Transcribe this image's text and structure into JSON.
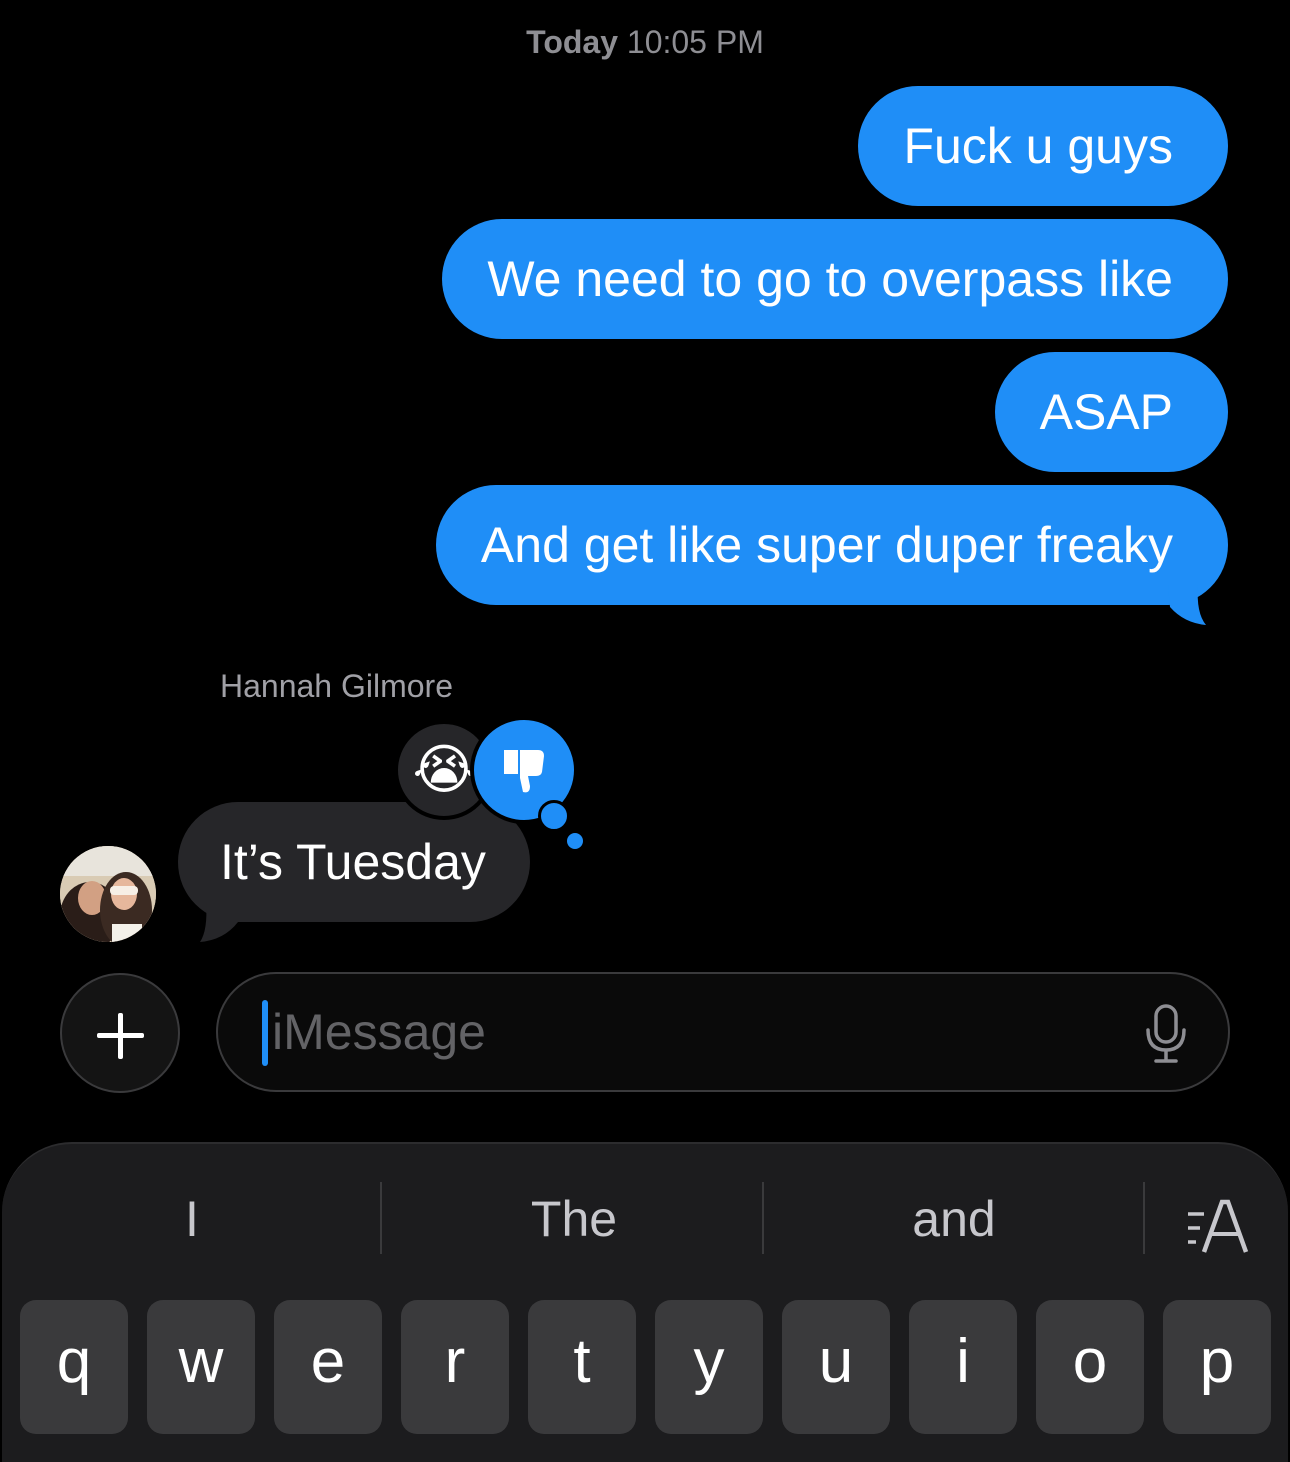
{
  "timestamp": {
    "day": "Today",
    "time": "10:05 PM"
  },
  "sent_messages": [
    "Fuck u guys",
    "We need to go to overpass like",
    "ASAP",
    "And get like super duper freaky"
  ],
  "received": {
    "sender_name": "Hannah Gilmore",
    "text": "It’s Tuesday",
    "tapbacks": [
      "😭",
      "thumbs-down-icon"
    ]
  },
  "composer": {
    "placeholder": "iMessage"
  },
  "keyboard": {
    "suggestions": [
      "I",
      "The",
      "and"
    ],
    "row1": [
      "q",
      "w",
      "e",
      "r",
      "t",
      "y",
      "u",
      "i",
      "o",
      "p"
    ]
  },
  "colors": {
    "sent_bubble": "#1f8ef7",
    "received_bubble": "#262629",
    "background": "#000000"
  }
}
